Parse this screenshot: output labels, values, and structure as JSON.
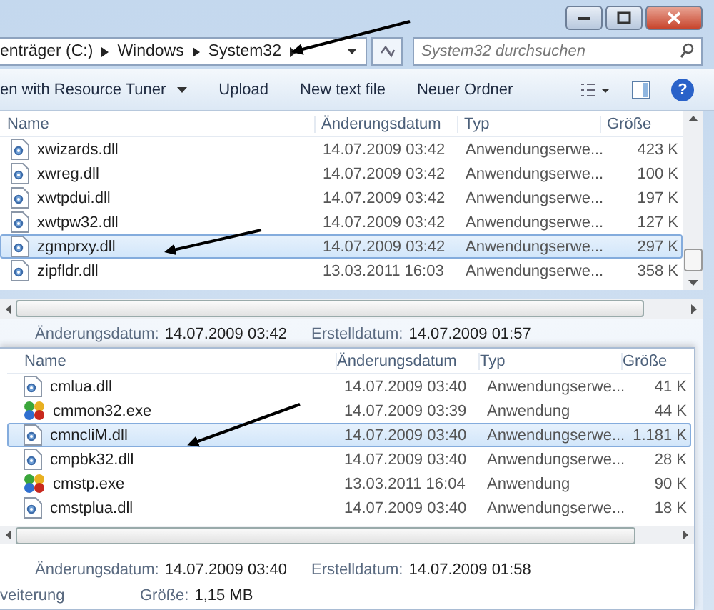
{
  "windows": [
    {
      "kind": "back",
      "address": {
        "crumbs": [
          "enträger (C:)",
          "Windows",
          "System32"
        ]
      },
      "search": {
        "placeholder": "System32 durchsuchen"
      },
      "toolbar": [
        {
          "label": "en with Resource Tuner",
          "dropdown": true
        },
        {
          "label": "Upload",
          "dropdown": false
        },
        {
          "label": "New text file",
          "dropdown": false
        },
        {
          "label": "Neuer Ordner",
          "dropdown": false
        }
      ],
      "help": "?",
      "columns": [
        "Name",
        "Änderungsdatum",
        "Typ",
        "Größe"
      ],
      "rows": [
        {
          "kind": "dll",
          "name": "xwizards.dll",
          "date": "14.07.2009 03:42",
          "type": "Anwendungserwe...",
          "size": "423 K",
          "selected": false
        },
        {
          "kind": "dll",
          "name": "xwreg.dll",
          "date": "14.07.2009 03:42",
          "type": "Anwendungserwe...",
          "size": "100 K",
          "selected": false
        },
        {
          "kind": "dll",
          "name": "xwtpdui.dll",
          "date": "14.07.2009 03:42",
          "type": "Anwendungserwe...",
          "size": "197 K",
          "selected": false
        },
        {
          "kind": "dll",
          "name": "xwtpw32.dll",
          "date": "14.07.2009 03:42",
          "type": "Anwendungserwe...",
          "size": "127 K",
          "selected": false
        },
        {
          "kind": "dll",
          "name": "zgmprxy.dll",
          "date": "14.07.2009 03:42",
          "type": "Anwendungserwe...",
          "size": "297 K",
          "selected": true
        },
        {
          "kind": "dll",
          "name": "zipfldr.dll",
          "date": "13.03.2011 16:03",
          "type": "Anwendungserwe...",
          "size": "358 K",
          "selected": false
        }
      ],
      "details": [
        [
          {
            "label": "Änderungsdatum:",
            "value": "14.07.2009 03:42"
          },
          {
            "label": "Erstelldatum:",
            "value": "14.07.2009 01:57"
          }
        ]
      ]
    },
    {
      "kind": "front",
      "columns": [
        "Name",
        "Änderungsdatum",
        "Typ",
        "Größe"
      ],
      "rows": [
        {
          "kind": "dll",
          "name": "cmlua.dll",
          "date": "14.07.2009 03:40",
          "type": "Anwendungserwe...",
          "size": "41 K",
          "selected": false
        },
        {
          "kind": "exe",
          "name": "cmmon32.exe",
          "date": "14.07.2009 03:39",
          "type": "Anwendung",
          "size": "44 K",
          "selected": false
        },
        {
          "kind": "dll",
          "name": "cmncliM.dll",
          "date": "14.07.2009 03:40",
          "type": "Anwendungserwe...",
          "size": "1.181 K",
          "selected": true
        },
        {
          "kind": "dll",
          "name": "cmpbk32.dll",
          "date": "14.07.2009 03:40",
          "type": "Anwendungserwe...",
          "size": "28 K",
          "selected": false
        },
        {
          "kind": "exe",
          "name": "cmstp.exe",
          "date": "13.03.2011 16:04",
          "type": "Anwendung",
          "size": "90 K",
          "selected": false
        },
        {
          "kind": "dll",
          "name": "cmstplua.dll",
          "date": "14.07.2009 03:40",
          "type": "Anwendungserwe...",
          "size": "18 K",
          "selected": false
        }
      ],
      "details": [
        [
          {
            "label": "Änderungsdatum:",
            "value": "14.07.2009 03:40"
          },
          {
            "label": "Erstelldatum:",
            "value": "14.07.2009 01:58"
          }
        ],
        [
          {
            "label": "veiterung"
          },
          {
            "label": "Größe:",
            "value": "1,15 MB"
          }
        ]
      ]
    }
  ]
}
